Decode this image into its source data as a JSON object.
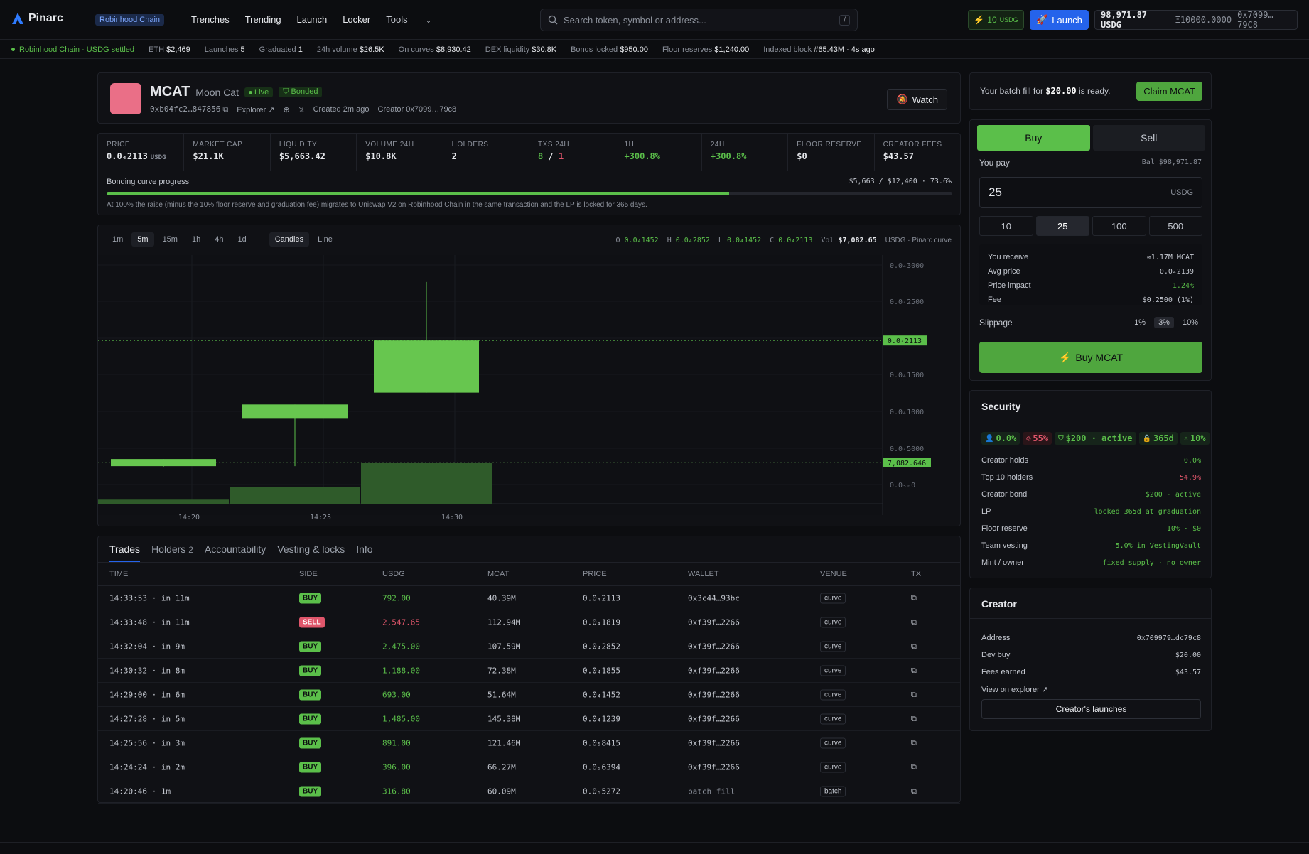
{
  "nav": {
    "brand": "Pinarc",
    "chain_badge": "Robinhood Chain",
    "links": [
      "Trenches",
      "Trending",
      "Launch",
      "Locker",
      "Tools"
    ],
    "search_placeholder": "Search token, symbol or address...",
    "search_shortcut": "/",
    "usdg_amount": "10",
    "usdg_unit": "USDG",
    "launch_label": "Launch",
    "wallet_balance": "98,971.87 USDG",
    "wallet_other": "Ξ10000.0000",
    "wallet_address": "0x7099…79C8"
  },
  "ticker": {
    "status": "Robinhood Chain · USDG settled",
    "items": [
      {
        "label": "ETH",
        "value": "$2,469"
      },
      {
        "label": "Launches",
        "value": "5"
      },
      {
        "label": "Graduated",
        "value": "1"
      },
      {
        "label": "24h volume",
        "value": "$26.5K"
      },
      {
        "label": "On curves",
        "value": "$8,930.42"
      },
      {
        "label": "DEX liquidity",
        "value": "$30.8K"
      },
      {
        "label": "Bonds locked",
        "value": "$950.00"
      },
      {
        "label": "Floor reserves",
        "value": "$1,240.00"
      },
      {
        "label": "Indexed block",
        "value": "#65.43M · 4s ago"
      }
    ]
  },
  "token": {
    "symbol": "MCAT",
    "name": "Moon Cat",
    "live": "Live",
    "bonded": "Bonded",
    "address": "0xb04fc2…847856",
    "explorer": "Explorer",
    "created": "Created 2m ago",
    "creator": "Creator 0x7099…79c8",
    "watch": "Watch"
  },
  "stats": [
    {
      "label": "PRICE",
      "value": "0.0₄2113",
      "unit": "USDG",
      "color": "#e6e8ec"
    },
    {
      "label": "MARKET CAP",
      "value": "$21.1K",
      "color": "#e6e8ec"
    },
    {
      "label": "LIQUIDITY",
      "value": "$5,663.42",
      "color": "#e6e8ec"
    },
    {
      "label": "VOLUME 24H",
      "value": "$10.8K",
      "color": "#e6e8ec"
    },
    {
      "label": "HOLDERS",
      "value": "2",
      "color": "#e6e8ec"
    },
    {
      "label": "TXS 24H",
      "value": "8 / 1",
      "color": "#e6e8ec"
    },
    {
      "label": "1H",
      "value": "+300.8%",
      "color": "#5bbf4a"
    },
    {
      "label": "24H",
      "value": "+300.8%",
      "color": "#5bbf4a"
    },
    {
      "label": "FLOOR RESERVE",
      "value": "$0",
      "color": "#e6e8ec"
    },
    {
      "label": "CREATOR FEES",
      "value": "$43.57",
      "color": "#e6e8ec"
    }
  ],
  "curve": {
    "label": "Bonding curve progress",
    "stat": "$5,663 / $12,400 · 73.6%",
    "progress": 0.736,
    "note": "At 100% the raise (minus the 10% floor reserve and graduation fee) migrates to Uniswap V2 on Robinhood Chain in the same transaction and the LP is locked for 365 days."
  },
  "chart_toolbar": {
    "timeframes": [
      "1m",
      "5m",
      "15m",
      "1h",
      "4h",
      "1d"
    ],
    "active_timeframe": "5m",
    "modes": [
      "Candles",
      "Line"
    ],
    "active_mode": "Candles",
    "ohlc": {
      "o": "0.0₄1452",
      "h": "0.0₄2852",
      "l": "0.0₄1452",
      "c": "0.0₄2113",
      "vol": "$7,082.65"
    },
    "source": "USDG · Pinarc curve"
  },
  "chart_data": {
    "type": "candlestick",
    "x_ticks": [
      "14:20",
      "14:25",
      "14:30"
    ],
    "y_ticks": [
      "0.0₄3000",
      "0.0₄2500",
      "0.0₄2000",
      "0.0₄1500",
      "0.0₄1000",
      "0.0₄5000",
      "0.0₅₀0"
    ],
    "current_price_label": "0.0₄2113",
    "volume_label": "7,082.646",
    "candles": [
      {
        "t": "14:20",
        "o": 0.61,
        "h": 0.61,
        "l": 0.51,
        "c": 0.52
      },
      {
        "t": "14:25",
        "o": 1.12,
        "h": 1.3,
        "l": 0.52,
        "c": 1.3
      },
      {
        "t": "14:30",
        "o": 1.45,
        "h": 2.85,
        "l": 1.45,
        "c": 2.11
      }
    ],
    "volume": [
      700,
      2850,
      7082.646
    ],
    "ylim": [
      0,
      3.1
    ]
  },
  "trades": {
    "tabs": [
      "Trades",
      "Holders",
      "Accountability",
      "Vesting & locks",
      "Info"
    ],
    "holders_count": "2",
    "columns": [
      "TIME",
      "SIDE",
      "USDG",
      "MCAT",
      "PRICE",
      "WALLET",
      "VENUE",
      "TX"
    ],
    "rows": [
      {
        "time": "14:33:53 · in 11m",
        "side": "BUY",
        "usdg": "792.00",
        "mcat": "40.39M",
        "price": "0.0₄2113",
        "wallet": "0x3c44…93bc",
        "venue": "curve"
      },
      {
        "time": "14:33:48 · in 11m",
        "side": "SELL",
        "usdg": "2,547.65",
        "mcat": "112.94M",
        "price": "0.0₄1819",
        "wallet": "0xf39f…2266",
        "venue": "curve"
      },
      {
        "time": "14:32:04 · in 9m",
        "side": "BUY",
        "usdg": "2,475.00",
        "mcat": "107.59M",
        "price": "0.0₄2852",
        "wallet": "0xf39f…2266",
        "venue": "curve"
      },
      {
        "time": "14:30:32 · in 8m",
        "side": "BUY",
        "usdg": "1,188.00",
        "mcat": "72.38M",
        "price": "0.0₄1855",
        "wallet": "0xf39f…2266",
        "venue": "curve"
      },
      {
        "time": "14:29:00 · in 6m",
        "side": "BUY",
        "usdg": "693.00",
        "mcat": "51.64M",
        "price": "0.0₄1452",
        "wallet": "0xf39f…2266",
        "venue": "curve"
      },
      {
        "time": "14:27:28 · in 5m",
        "side": "BUY",
        "usdg": "1,485.00",
        "mcat": "145.38M",
        "price": "0.0₄1239",
        "wallet": "0xf39f…2266",
        "venue": "curve"
      },
      {
        "time": "14:25:56 · in 3m",
        "side": "BUY",
        "usdg": "891.00",
        "mcat": "121.46M",
        "price": "0.0₅8415",
        "wallet": "0xf39f…2266",
        "venue": "curve"
      },
      {
        "time": "14:24:24 · in 2m",
        "side": "BUY",
        "usdg": "396.00",
        "mcat": "66.27M",
        "price": "0.0₅6394",
        "wallet": "0xf39f…2266",
        "venue": "curve"
      },
      {
        "time": "14:20:46 · 1m",
        "side": "BUY",
        "usdg": "316.80",
        "mcat": "60.09M",
        "price": "0.0₅5272",
        "wallet": "batch fill",
        "venue": "batch"
      }
    ]
  },
  "claim": {
    "text_prefix": "Your batch fill for",
    "amount": "$20.00",
    "text_suffix": "is ready.",
    "button": "Claim MCAT"
  },
  "trade": {
    "buy_tab": "Buy",
    "sell_tab": "Sell",
    "you_pay": "You pay",
    "balance": "Bal $98,971.87",
    "amount": "25",
    "unit": "USDG",
    "presets": [
      "10",
      "25",
      "100",
      "500"
    ],
    "active_preset": "25",
    "quote": [
      {
        "label": "You receive",
        "value": "≈1.17M MCAT",
        "color": "#c3c7cf"
      },
      {
        "label": "Avg price",
        "value": "0.0₄2139",
        "color": "#c3c7cf"
      },
      {
        "label": "Price impact",
        "value": "1.24%",
        "color": "#5bbf4a"
      },
      {
        "label": "Fee",
        "value": "$0.2500 (1%)",
        "color": "#c3c7cf"
      }
    ],
    "slippage_label": "Slippage",
    "slippage_opts": [
      "1%",
      "3%",
      "10%"
    ],
    "slippage_active": "3%",
    "buy_button": "Buy MCAT"
  },
  "security": {
    "title": "Security",
    "chips": [
      {
        "icon": "user-icon",
        "text": "0.0%",
        "tone": "green"
      },
      {
        "icon": "target-icon",
        "text": "55%",
        "tone": "red"
      },
      {
        "icon": "shield-icon",
        "text": "$200 · active",
        "tone": "green"
      },
      {
        "icon": "lock-icon",
        "text": "365d",
        "tone": "green"
      },
      {
        "icon": "warning-icon",
        "text": "10%",
        "tone": "green"
      }
    ],
    "rows": [
      {
        "label": "Creator holds",
        "value": "0.0%",
        "color": "#5bbf4a"
      },
      {
        "label": "Top 10 holders",
        "value": "54.9%",
        "color": "#e0566b"
      },
      {
        "label": "Creator bond",
        "value": "$200 · active",
        "color": "#5bbf4a"
      },
      {
        "label": "LP",
        "value": "locked 365d at graduation",
        "color": "#5bbf4a"
      },
      {
        "label": "Floor reserve",
        "value": "10% · $0",
        "color": "#5bbf4a"
      },
      {
        "label": "Team vesting",
        "value": "5.0% in VestingVault",
        "color": "#5bbf4a"
      },
      {
        "label": "Mint / owner",
        "value": "fixed supply · no owner",
        "color": "#5bbf4a"
      }
    ]
  },
  "creator": {
    "title": "Creator",
    "rows": [
      {
        "label": "Address",
        "value": "0x709979…dc79c8"
      },
      {
        "label": "Dev buy",
        "value": "$20.00"
      },
      {
        "label": "Fees earned",
        "value": "$43.57"
      }
    ],
    "explorer_link": "View on explorer ↗",
    "launches_button": "Creator's launches"
  }
}
